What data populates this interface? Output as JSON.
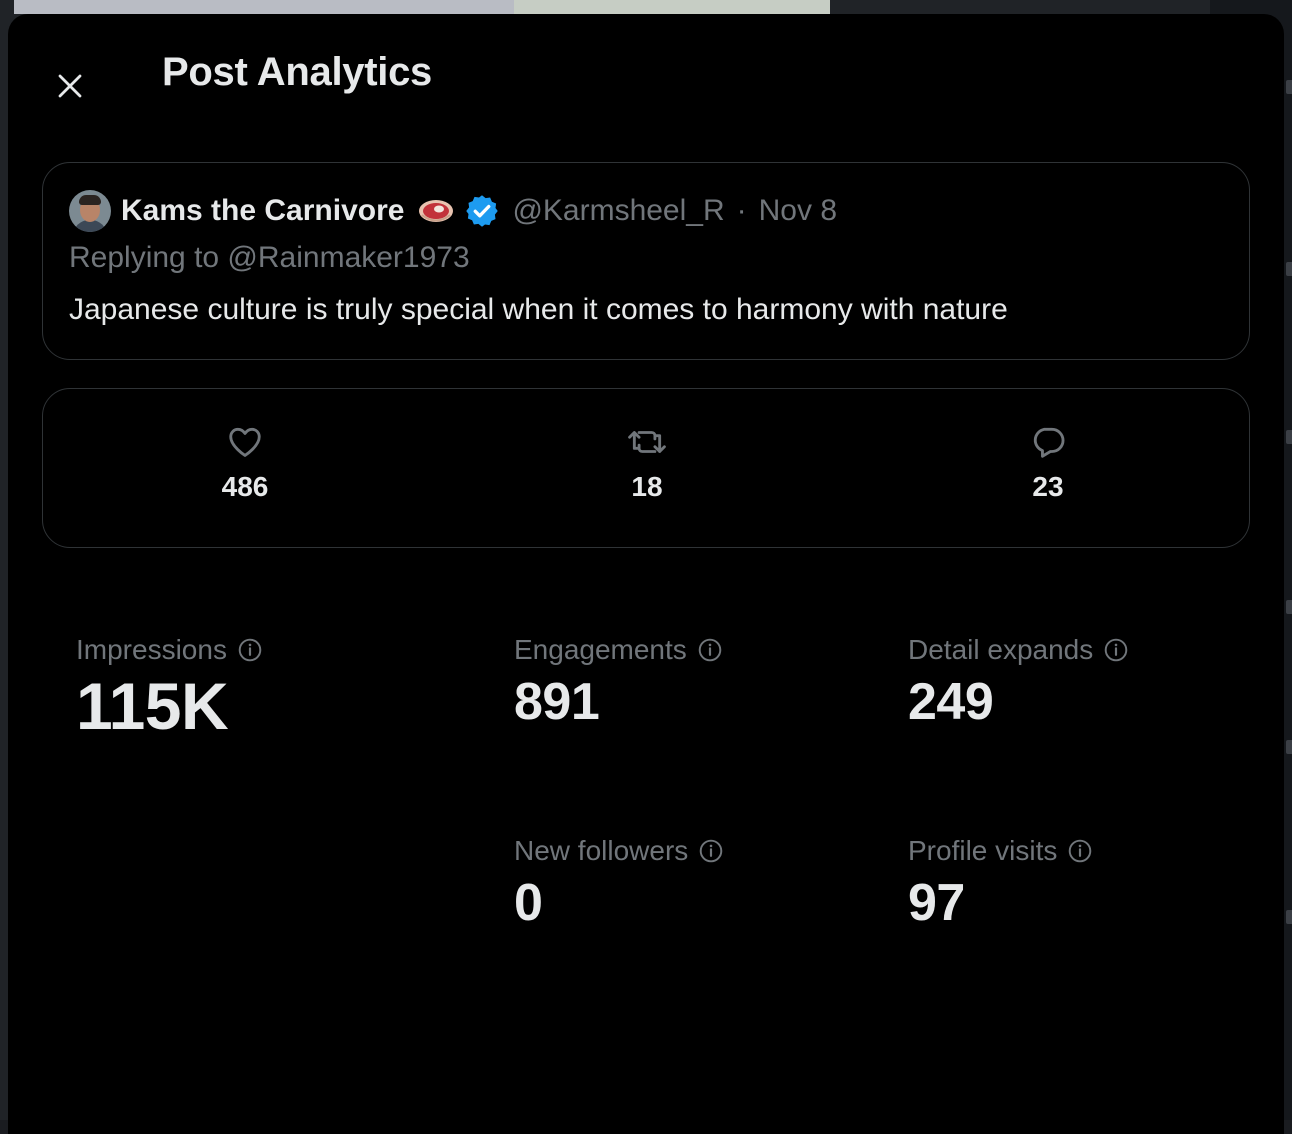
{
  "modal": {
    "title": "Post Analytics"
  },
  "post": {
    "author_name": "Kams the Carnivore",
    "handle": "@Karmsheel_R",
    "separator": "·",
    "date": "Nov 8",
    "replying_to": "Replying to @Rainmaker1973",
    "text": "Japanese culture is truly special when it comes to harmony with nature",
    "verified": true
  },
  "engagement": {
    "likes": "486",
    "reposts": "18",
    "replies": "23"
  },
  "metrics": {
    "impressions": {
      "label": "Impressions",
      "value": "115K"
    },
    "engagements": {
      "label": "Engagements",
      "value": "891"
    },
    "detail_expands": {
      "label": "Detail expands",
      "value": "249"
    },
    "new_followers": {
      "label": "New followers",
      "value": "0"
    },
    "profile_visits": {
      "label": "Profile visits",
      "value": "97"
    }
  },
  "colors": {
    "background": "#000000",
    "text_primary": "#e7e9ea",
    "text_secondary": "#71767b",
    "border": "#2f3336",
    "verified": "#1d9bf0"
  },
  "icons": {
    "close": "close-icon",
    "verified": "verified-badge-icon",
    "emoji": "steak-emoji-icon",
    "like": "heart-icon",
    "repost": "repost-icon",
    "reply": "reply-icon",
    "info": "info-icon"
  }
}
